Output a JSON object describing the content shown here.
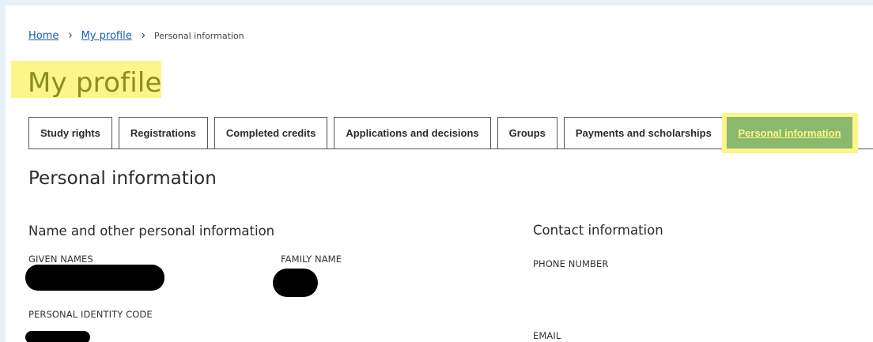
{
  "breadcrumb": {
    "home": "Home",
    "separator_1": "›",
    "my_profile": "My profile",
    "separator_2": "›",
    "current": "Personal information"
  },
  "page_title": "My profile",
  "tabs": [
    {
      "label": "Study rights"
    },
    {
      "label": "Registrations"
    },
    {
      "label": "Completed credits"
    },
    {
      "label": "Applications and decisions"
    },
    {
      "label": "Groups"
    },
    {
      "label": "Payments and scholarships"
    },
    {
      "label": "Personal information",
      "active": true
    }
  ],
  "section_title": "Personal information",
  "name_section": {
    "heading": "Name and other personal information",
    "given_names_label": "GIVEN NAMES",
    "family_name_label": "FAMILY NAME",
    "personal_identity_code_label": "PERSONAL IDENTITY CODE"
  },
  "contact_section": {
    "heading": "Contact information",
    "phone_number_label": "PHONE NUMBER",
    "email_label": "EMAIL"
  },
  "colors": {
    "link": "#1a5ea8",
    "highlight": "#fbf58a",
    "active_tab": "#8ab86c",
    "title": "#8c8c24"
  }
}
